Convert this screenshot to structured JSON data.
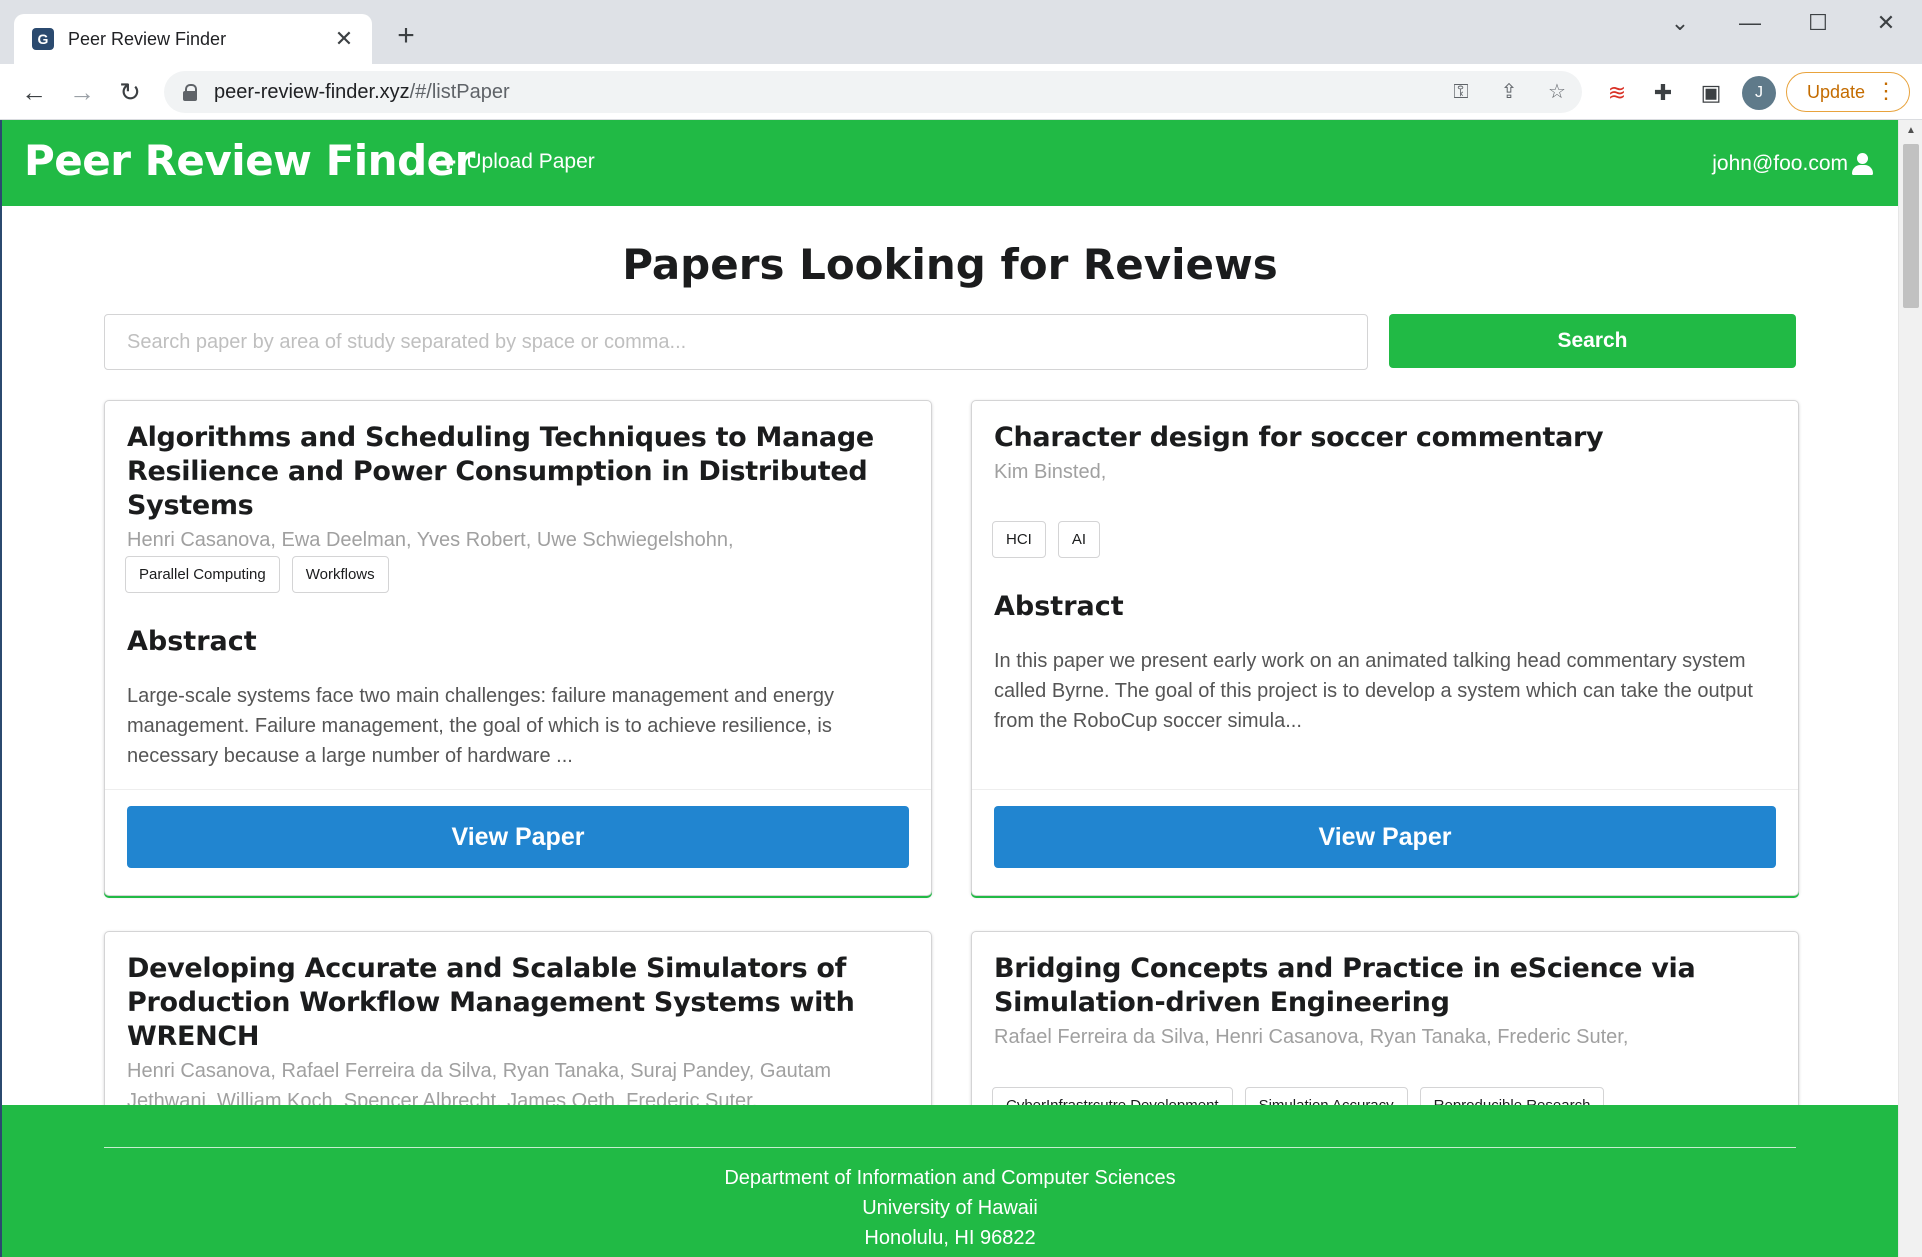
{
  "browser": {
    "tab_title": "Peer Review Finder",
    "favicon_glyph": "G",
    "url_host": "peer-review-finder.xyz",
    "url_path": "/#/listPaper",
    "update_label": "Update",
    "avatar_letter": "J"
  },
  "colors": {
    "brand_green": "#21ba45",
    "button_blue": "#2185d0"
  },
  "navbar": {
    "brand": "Peer Review Finder",
    "upload_label": "Upload Paper",
    "user_email": "john@foo.com"
  },
  "page": {
    "heading": "Papers Looking for Reviews",
    "search_placeholder": "Search paper by area of study separated by space or comma...",
    "search_button": "Search"
  },
  "papers": [
    {
      "title": "Algorithms and Scheduling Techniques to Manage Resilience and Power Consumption in Distributed Systems",
      "authors": "Henri Casanova, Ewa Deelman, Yves Robert, Uwe Schwiegelshohn,",
      "tags": [
        "Parallel Computing",
        "Workflows"
      ],
      "abstract_heading": "Abstract",
      "abstract": "Large-scale systems face two main challenges: failure management and energy management. Failure management, the goal of which is to achieve resilience, is necessary because a large number of hardware ...",
      "button": "View Paper"
    },
    {
      "title": "Character design for soccer commentary",
      "authors": "Kim Binsted,",
      "tags": [
        "HCI",
        "AI"
      ],
      "abstract_heading": "Abstract",
      "abstract": "In this paper we present early work on an animated talking head commentary system called Byrne. The goal of this project is to develop a system which can take the output from the RoboCup soccer simula...",
      "button": "View Paper"
    },
    {
      "title": "Developing Accurate and Scalable Simulators of Production Workflow Management Systems with WRENCH",
      "authors": "Henri Casanova, Rafael Ferreira da Silva, Ryan Tanaka, Suraj Pandey, Gautam Jethwani, William Koch, Spencer Albrecht, James Oeth, Frederic Suter,",
      "tags": [],
      "abstract_heading": "",
      "abstract": "",
      "button": ""
    },
    {
      "title": "Bridging Concepts and Practice in eScience via Simulation-driven Engineering",
      "authors": "Rafael Ferreira da Silva, Henri Casanova, Ryan Tanaka, Frederic Suter,",
      "tags": [
        "CyberInfrastrcutre Development",
        "Simulation Accuracy",
        "Reproducible Research"
      ],
      "abstract_heading": "",
      "abstract": "",
      "button": ""
    }
  ],
  "footer": {
    "line1": "Department of Information and Computer Sciences",
    "line2": "University of Hawaii",
    "line3": "Honolulu, HI 96822"
  }
}
